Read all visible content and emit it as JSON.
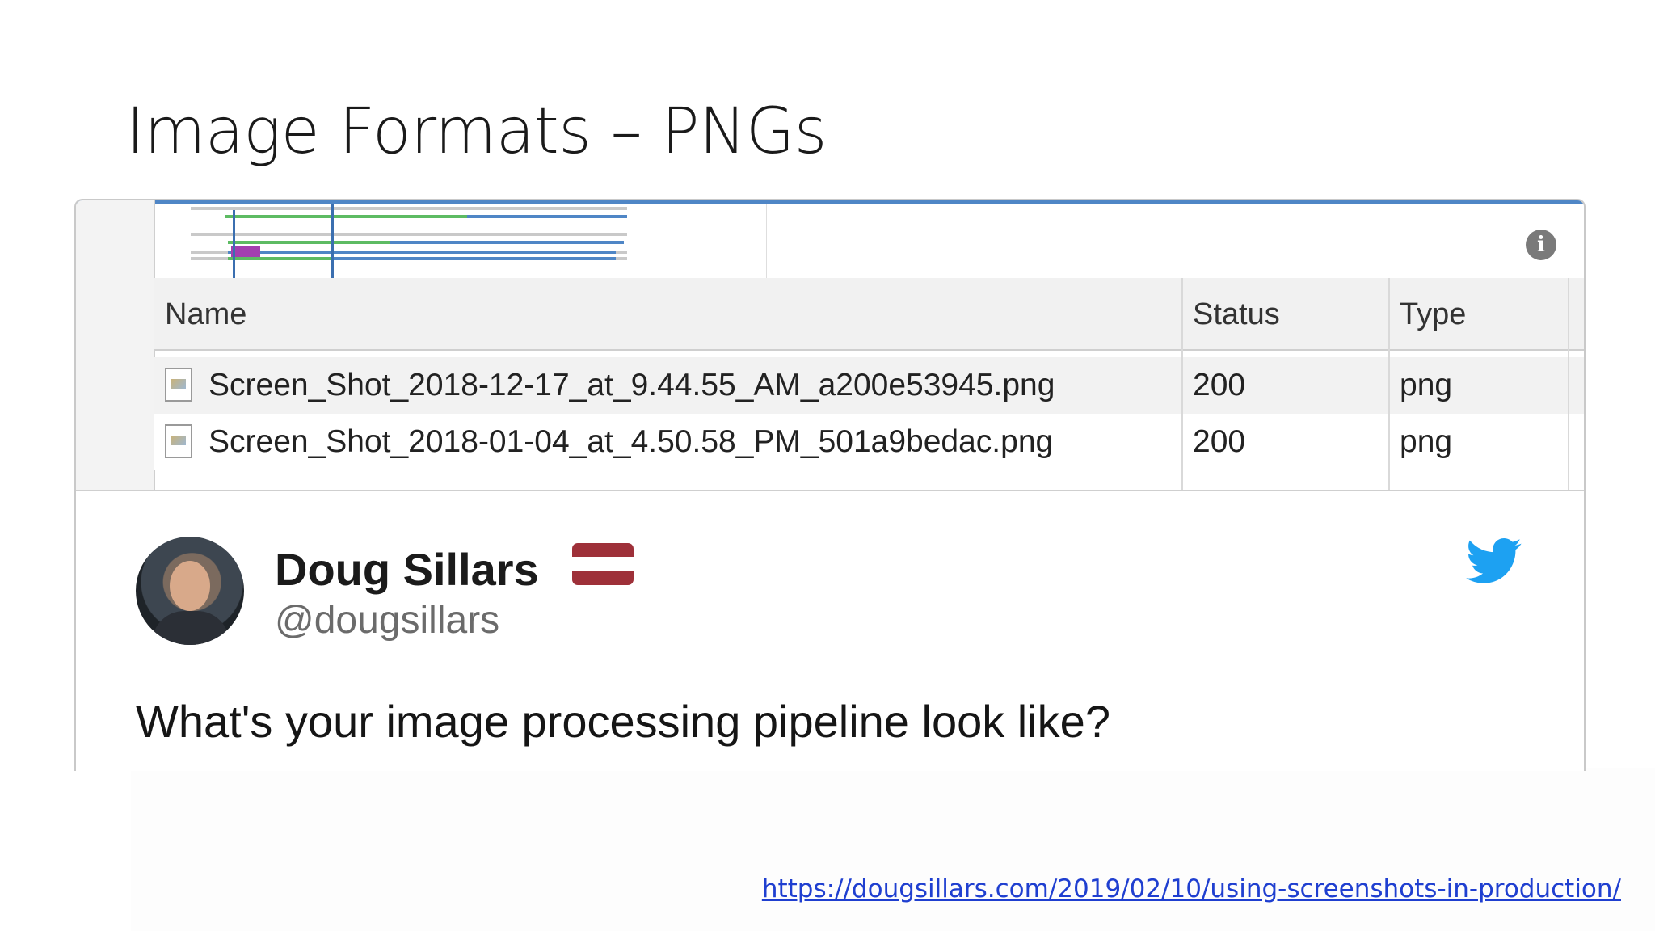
{
  "slide": {
    "title": "Image Formats – PNGs",
    "source_url": "https://dougsillars.com/2019/02/10/using-screenshots-in-production/"
  },
  "network_panel": {
    "columns": [
      "Name",
      "Status",
      "Type"
    ],
    "rows": [
      {
        "name": "Screen_Shot_2018-12-17_at_9.44.55_AM_a200e53945.png",
        "status": "200",
        "type": "png"
      },
      {
        "name": "Screen_Shot_2018-01-04_at_4.50.58_PM_501a9bedac.png",
        "status": "200",
        "type": "png"
      }
    ],
    "icons": {
      "info": "info-icon",
      "file": "image-file-icon"
    },
    "waterfall_color": "#4f86c6"
  },
  "tweet": {
    "author": "Doug Sillars",
    "handle": "@dougsillars",
    "text": "What's your image processing pipeline look like?",
    "flag_colors": [
      "#9e3039",
      "#ffffff",
      "#9e3039"
    ],
    "brand_color": "#1da1f2",
    "icons": {
      "brand": "twitter-bird-icon",
      "flag": "flag-icon"
    }
  }
}
